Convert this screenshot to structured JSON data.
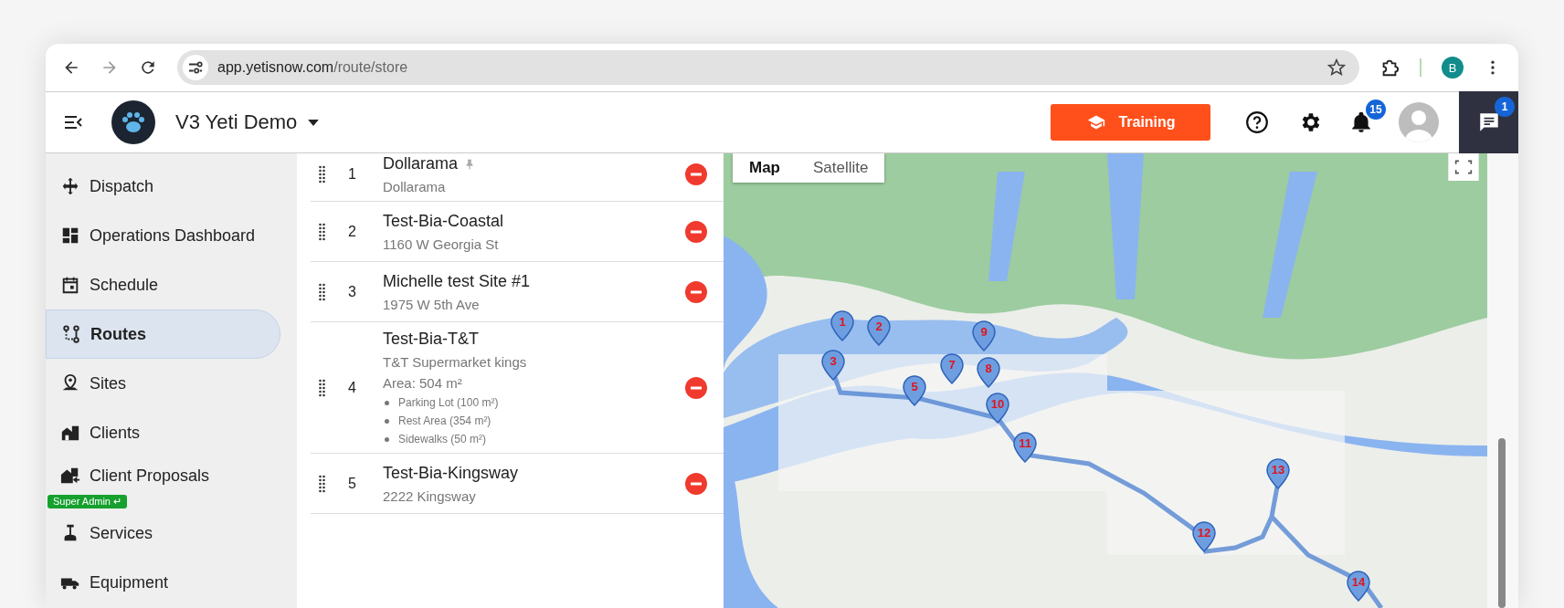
{
  "browser": {
    "url_host": "app.yetisnow.com",
    "url_path": "/route/store",
    "profile_initial": "B"
  },
  "header": {
    "org_name": "V3 Yeti Demo",
    "training_label": "Training",
    "notifications_count": "15",
    "chat_count": "1"
  },
  "sidebar": {
    "items": [
      {
        "label": "Dispatch",
        "selected": false
      },
      {
        "label": "Operations Dashboard",
        "selected": false
      },
      {
        "label": "Schedule",
        "selected": false
      },
      {
        "label": "Routes",
        "selected": true
      },
      {
        "label": "Sites",
        "selected": false
      },
      {
        "label": "Clients",
        "selected": false
      },
      {
        "label": "Client Proposals",
        "selected": false,
        "badge": "Super Admin ↵"
      },
      {
        "label": "Services",
        "selected": false
      },
      {
        "label": "Equipment",
        "selected": false
      }
    ]
  },
  "route_stops": [
    {
      "number": "1",
      "name": "Dollarama",
      "pinned": true,
      "address": "Dollarama"
    },
    {
      "number": "2",
      "name": "Test-Bia-Coastal",
      "pinned": false,
      "address": "1160 W Georgia St"
    },
    {
      "number": "3",
      "name": "Michelle test Site #1",
      "pinned": false,
      "address": "1975 W 5th Ave"
    },
    {
      "number": "4",
      "name": "Test-Bia-T&T",
      "pinned": false,
      "address": "T&T Supermarket kings",
      "area": "Area: 504 m²",
      "services": [
        "Parking Lot (100 m²)",
        "Rest Area (354 m²)",
        "Sidewalks (50 m²)"
      ]
    },
    {
      "number": "5",
      "name": "Test-Bia-Kingsway",
      "pinned": false,
      "address": "2222 Kingsway"
    }
  ],
  "map": {
    "tabs": [
      {
        "label": "Map",
        "selected": true
      },
      {
        "label": "Satellite",
        "selected": false
      }
    ],
    "markers": [
      {
        "label": "1"
      },
      {
        "label": "2"
      },
      {
        "label": "3"
      },
      {
        "label": "5"
      },
      {
        "label": "7"
      },
      {
        "label": "8"
      },
      {
        "label": "9"
      },
      {
        "label": "10"
      },
      {
        "label": "11"
      },
      {
        "label": "12"
      },
      {
        "label": "13"
      },
      {
        "label": "14"
      }
    ]
  }
}
